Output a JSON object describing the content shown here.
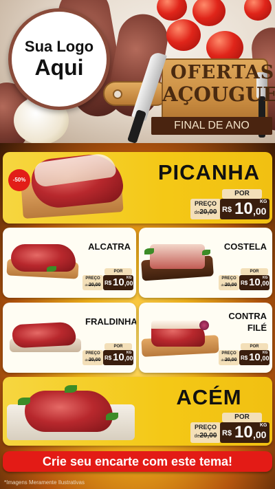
{
  "header": {
    "logo_line1": "Sua Logo",
    "logo_line2": "Aqui",
    "title_line1": "OFERTAS",
    "title_line2": "AÇOUGUE",
    "subtitle": "FINAL DE ANO"
  },
  "featured": [
    {
      "name": "PICANHA",
      "discount": "-50%",
      "por_label": "POR",
      "preco_label": "PREÇO",
      "old_prefix": "de",
      "old_price": "20,00",
      "currency": "R$",
      "price_int": "10",
      "price_dec": ",00",
      "unit": "KG"
    },
    {
      "name": "ACÉM",
      "por_label": "POR",
      "preco_label": "PREÇO",
      "old_prefix": "de",
      "old_price": "20,00",
      "currency": "R$",
      "price_int": "10",
      "price_dec": ",00",
      "unit": "KG"
    }
  ],
  "products": [
    {
      "name": "ALCATRA",
      "por_label": "POR",
      "preco_label": "PREÇO",
      "old_prefix": "de",
      "old_price": "20,00",
      "currency": "R$",
      "price_int": "10",
      "price_dec": ",00",
      "unit": "KG"
    },
    {
      "name": "COSTELA",
      "por_label": "POR",
      "preco_label": "PREÇO",
      "old_prefix": "de",
      "old_price": "20,00",
      "currency": "R$",
      "price_int": "10",
      "price_dec": ",00",
      "unit": "KG"
    },
    {
      "name": "FRALDINHA",
      "por_label": "POR",
      "preco_label": "PREÇO",
      "old_prefix": "de",
      "old_price": "20,00",
      "currency": "R$",
      "price_int": "10",
      "price_dec": ",00",
      "unit": "KG"
    },
    {
      "name_line1": "CONTRA",
      "name_line2": "FILÉ",
      "por_label": "POR",
      "preco_label": "PREÇO",
      "old_prefix": "de",
      "old_price": "20,00",
      "currency": "R$",
      "price_int": "10",
      "price_dec": ",00",
      "unit": "KG"
    }
  ],
  "cta": "Crie seu encarte com este tema!",
  "disclaimer": "*Imagens Meramente Ilustrativas",
  "colors": {
    "accent_red": "#e31b16",
    "featured_yellow": "#f4c816",
    "price_dark": "#3a1e0e",
    "price_tag_light": "#f3dfb8"
  }
}
